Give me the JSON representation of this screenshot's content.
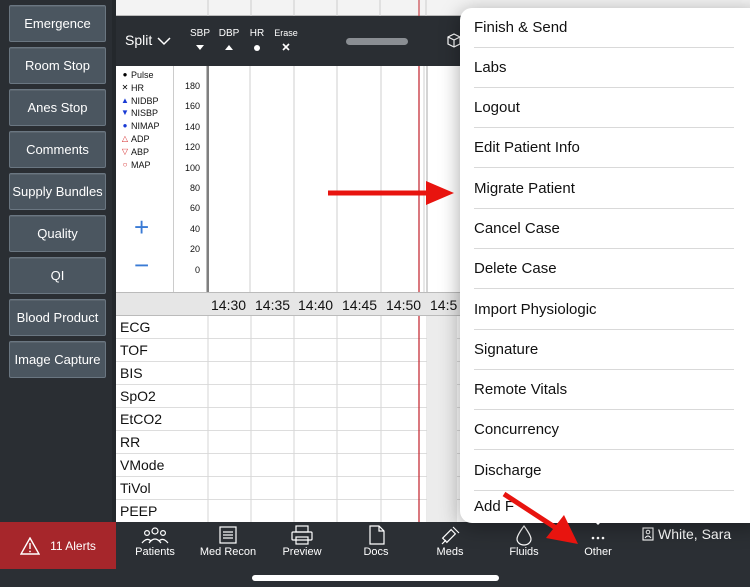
{
  "sidebar": {
    "buttons": [
      "Emergence",
      "Room Stop",
      "Anes Stop",
      "Comments",
      "Supply Bundles",
      "Quality",
      "QI",
      "Blood Product",
      "Image Capture"
    ]
  },
  "toolbar": {
    "split_label": "Split",
    "sbp_label": "SBP",
    "dbp_label": "DBP",
    "hr_label": "HR",
    "erase_label": "Erase"
  },
  "legend": [
    {
      "symbol": "●",
      "label": "Pulse",
      "color": "#000000"
    },
    {
      "symbol": "✕",
      "label": "HR",
      "color": "#000000"
    },
    {
      "symbol": "▲",
      "label": "NIDBP",
      "color": "#1a3bd4"
    },
    {
      "symbol": "▼",
      "label": "NISBP",
      "color": "#1a3bd4"
    },
    {
      "symbol": "●",
      "label": "NIMAP",
      "color": "#1a3bd4"
    },
    {
      "symbol": "△",
      "label": "ADP",
      "color": "#d42a2a"
    },
    {
      "symbol": "▽",
      "label": "ABP",
      "color": "#d42a2a"
    },
    {
      "symbol": "○",
      "label": "MAP",
      "color": "#d42a2a"
    }
  ],
  "yaxis": [
    "180",
    "160",
    "140",
    "120",
    "100",
    "80",
    "60",
    "40",
    "20",
    "0"
  ],
  "zoom": {
    "plus": "+",
    "minus": "−"
  },
  "times": [
    "14:30",
    "14:35",
    "14:40",
    "14:45",
    "14:50",
    "14:5"
  ],
  "rows": [
    "ECG",
    "TOF",
    "BIS",
    "SpO2",
    "EtCO2",
    "RR",
    "VMode",
    "TiVol",
    "PEEP"
  ],
  "menu": {
    "items": [
      "Finish & Send",
      "Labs",
      "Logout",
      "Edit Patient Info",
      "Migrate Patient",
      "Cancel Case",
      "Delete Case",
      "Import Physiologic",
      "Signature",
      "Remote Vitals",
      "Concurrency",
      "Discharge",
      "Add F"
    ]
  },
  "bottom": {
    "alerts": "11 Alerts",
    "nav": [
      {
        "label": "Patients",
        "icon": "patients-icon"
      },
      {
        "label": "Med Recon",
        "icon": "list-icon"
      },
      {
        "label": "Preview",
        "icon": "printer-icon"
      },
      {
        "label": "Docs",
        "icon": "document-icon"
      },
      {
        "label": "Meds",
        "icon": "syringe-icon"
      },
      {
        "label": "Fluids",
        "icon": "drop-icon"
      },
      {
        "label": "Other",
        "icon": "ellipsis-icon"
      }
    ],
    "user": "White, Sara"
  },
  "colors": {
    "alert_red": "#a6262b",
    "arrow_red": "#e8140f",
    "sidebar_button": "#4b5660",
    "time_marker": "#c2202a"
  }
}
